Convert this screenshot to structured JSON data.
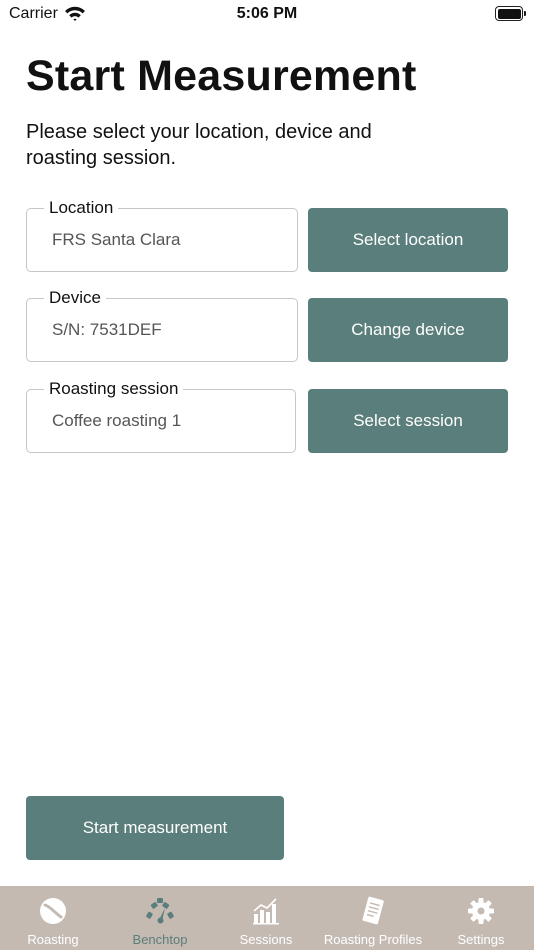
{
  "status_bar": {
    "carrier": "Carrier",
    "time": "5:06 PM"
  },
  "header": {
    "title": "Start Measurement",
    "subtitle": "Please select your location, device and roasting session."
  },
  "form": {
    "location": {
      "label": "Location",
      "value": "FRS Santa Clara",
      "button": "Select location"
    },
    "device": {
      "label": "Device",
      "value": "S/N: 7531DEF",
      "button": "Change device"
    },
    "session": {
      "label": "Roasting session",
      "value": "Coffee roasting 1",
      "button": "Select session"
    }
  },
  "actions": {
    "start": "Start measurement"
  },
  "tabs": [
    {
      "label": "Roasting",
      "icon": "coffee-bean-icon",
      "active": false
    },
    {
      "label": "Benchtop",
      "icon": "gauge-icon",
      "active": true
    },
    {
      "label": "Sessions",
      "icon": "bar-chart-icon",
      "active": false
    },
    {
      "label": "Roasting Profiles",
      "icon": "document-icon",
      "active": false
    },
    {
      "label": "Settings",
      "icon": "gear-icon",
      "active": false
    }
  ],
  "colors": {
    "accent": "#5a7e7b",
    "tab_bar": "#c4bab2",
    "tab_inactive": "#ffffff"
  }
}
